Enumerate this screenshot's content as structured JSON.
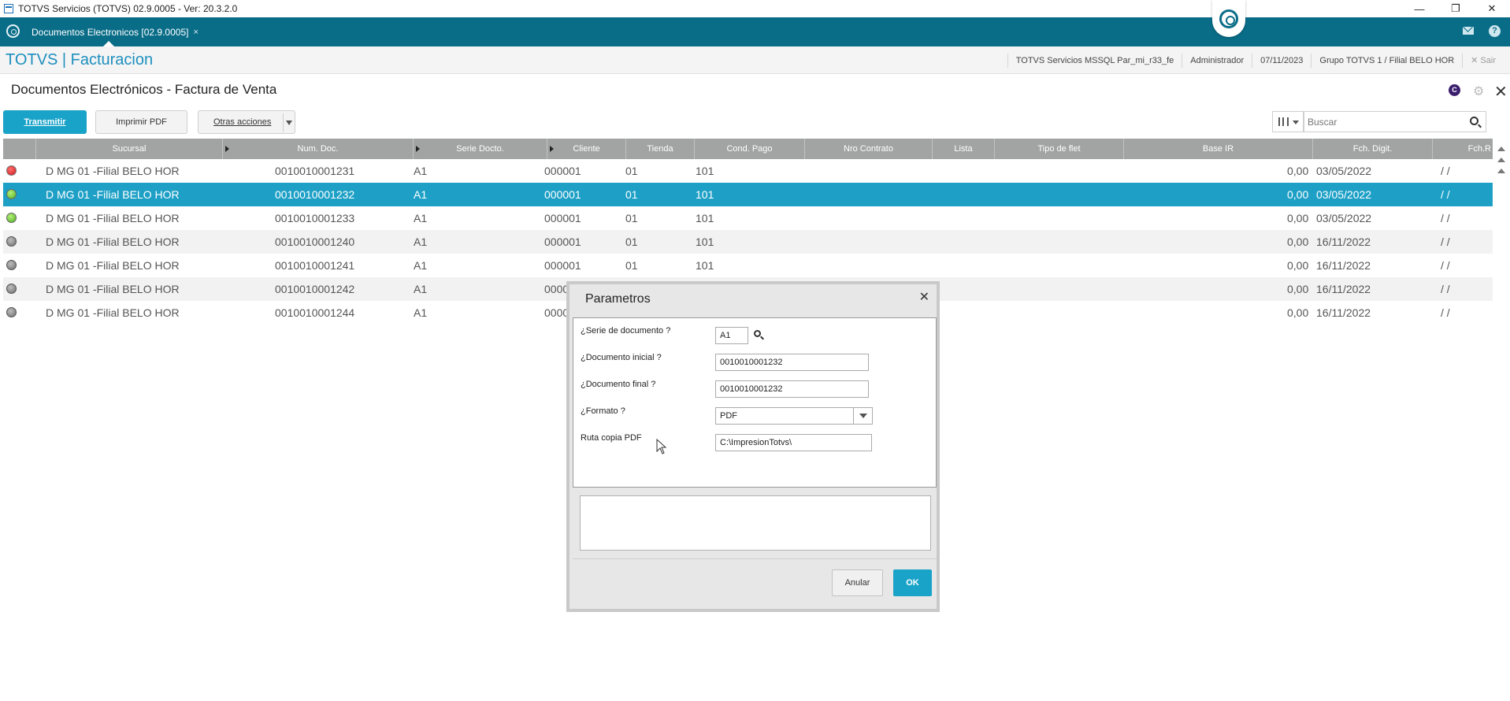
{
  "window": {
    "title": "TOTVS Servicios (TOTVS) 02.9.0005 - Ver: 20.3.2.0",
    "minimize": "—",
    "restore": "❐",
    "close": "✕"
  },
  "tabbar": {
    "tab_label": "Documentos Electronicos [02.9.0005]",
    "tab_close": "×",
    "accent_color": "#0a6d88"
  },
  "header": {
    "brand": "TOTVS | Facturacion",
    "server": "TOTVS Servicios MSSQL Par_mi_r33_fe",
    "user": "Administrador",
    "date": "07/11/2023",
    "branch": "Grupo TOTVS 1 / Filial BELO HOR",
    "exit": "✕ Sair"
  },
  "page": {
    "title": "Documentos Electrónicos - Factura de Venta",
    "c_badge": "C"
  },
  "toolbar": {
    "transmitir": "Transmitir",
    "imprimir_pdf": "Imprimir PDF",
    "otras_acciones": "Otras acciones",
    "search_placeholder": "Buscar"
  },
  "grid": {
    "columns": [
      "Sucursal",
      "Num. Doc.",
      "Serie Docto.",
      "Cliente",
      "Tienda",
      "Cond. Pago",
      "Nro Contrato",
      "Lista",
      "Tipo de flet",
      "Base IR",
      "Fch. Digit.",
      "Fch.R"
    ],
    "rows": [
      {
        "status": "red",
        "sucursal": "D MG 01 -Filial BELO HOR",
        "num_doc": "0010010001231",
        "serie": "A1",
        "cliente": "000001",
        "tienda": "01",
        "cond_pago": "101",
        "base_ir": "0,00",
        "fch_digit": "03/05/2022",
        "fch_r": "/ /"
      },
      {
        "status": "green",
        "sucursal": "D MG 01 -Filial BELO HOR",
        "num_doc": "0010010001232",
        "serie": "A1",
        "cliente": "000001",
        "tienda": "01",
        "cond_pago": "101",
        "base_ir": "0,00",
        "fch_digit": "03/05/2022",
        "fch_r": "/ /"
      },
      {
        "status": "green",
        "sucursal": "D MG 01 -Filial BELO HOR",
        "num_doc": "0010010001233",
        "serie": "A1",
        "cliente": "000001",
        "tienda": "01",
        "cond_pago": "101",
        "base_ir": "0,00",
        "fch_digit": "03/05/2022",
        "fch_r": "/ /"
      },
      {
        "status": "gray",
        "sucursal": "D MG 01 -Filial BELO HOR",
        "num_doc": "0010010001240",
        "serie": "A1",
        "cliente": "000001",
        "tienda": "01",
        "cond_pago": "101",
        "base_ir": "0,00",
        "fch_digit": "16/11/2022",
        "fch_r": "/ /"
      },
      {
        "status": "gray",
        "sucursal": "D MG 01 -Filial BELO HOR",
        "num_doc": "0010010001241",
        "serie": "A1",
        "cliente": "000001",
        "tienda": "01",
        "cond_pago": "101",
        "base_ir": "0,00",
        "fch_digit": "16/11/2022",
        "fch_r": "/ /"
      },
      {
        "status": "gray",
        "sucursal": "D MG 01 -Filial BELO HOR",
        "num_doc": "0010010001242",
        "serie": "A1",
        "cliente": "0000",
        "tienda": "",
        "cond_pago": "",
        "base_ir": "0,00",
        "fch_digit": "16/11/2022",
        "fch_r": "/ /"
      },
      {
        "status": "gray",
        "sucursal": "D MG 01 -Filial BELO HOR",
        "num_doc": "0010010001244",
        "serie": "A1",
        "cliente": "0000",
        "tienda": "",
        "cond_pago": "",
        "base_ir": "0,00",
        "fch_digit": "16/11/2022",
        "fch_r": "/ /"
      }
    ],
    "selected_row_color": "#1ea0c6"
  },
  "dialog": {
    "title": "Parametros",
    "close": "✕",
    "fields": {
      "serie_label": "¿Serie de documento ?",
      "serie_value": "A1",
      "doc_inicial_label": "¿Documento inicial ?",
      "doc_inicial_value": "0010010001232",
      "doc_final_label": "¿Documento final ?",
      "doc_final_value": "0010010001232",
      "formato_label": "¿Formato ?",
      "formato_value": "PDF",
      "ruta_label": "Ruta copia PDF",
      "ruta_value": "C:\\ImpresionTotvs\\"
    },
    "anular": "Anular",
    "ok": "OK"
  }
}
